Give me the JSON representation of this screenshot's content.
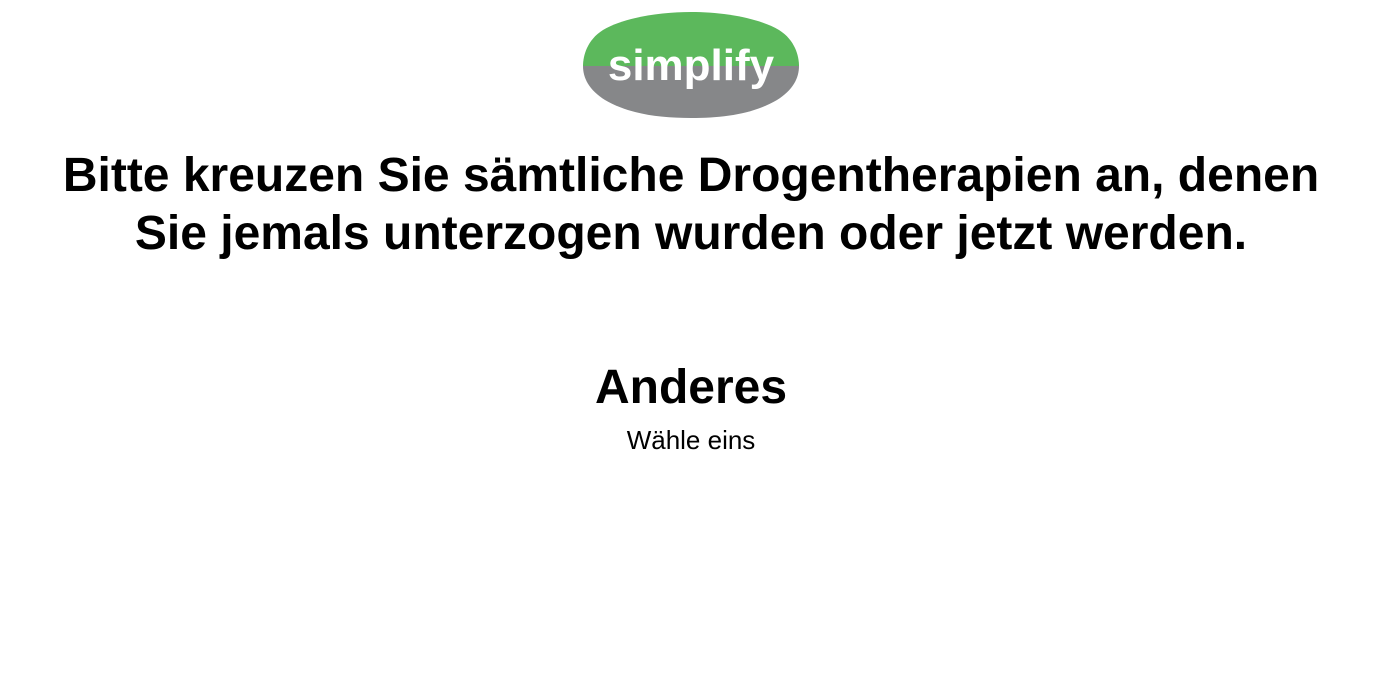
{
  "brand": {
    "logo_text": "simplify",
    "colors": {
      "logo_top": "#5cb85c",
      "logo_bottom": "#868789",
      "logo_text": "#ffffff"
    }
  },
  "question": {
    "text": "Bitte kreuzen Sie sämtliche Drogentherapien an, denen Sie jemals unterzogen wurden oder jetzt werden."
  },
  "section": {
    "title": "Anderes",
    "hint": "Wähle eins"
  }
}
